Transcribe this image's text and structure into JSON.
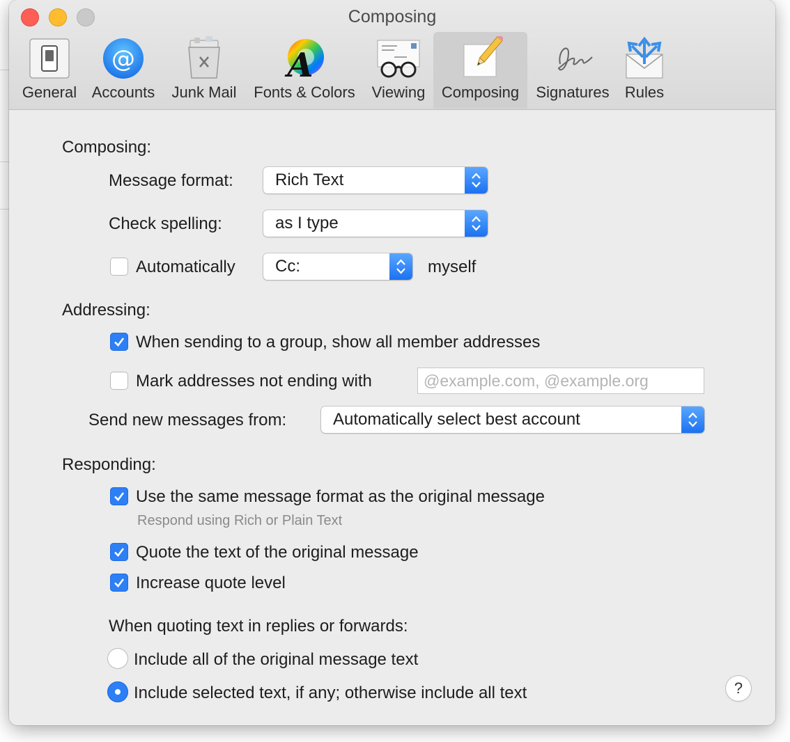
{
  "window": {
    "title": "Composing"
  },
  "toolbar": {
    "items": [
      {
        "label": "General",
        "icon": "general-switch-icon"
      },
      {
        "label": "Accounts",
        "icon": "at-sign-icon"
      },
      {
        "label": "Junk Mail",
        "icon": "trash-can-icon"
      },
      {
        "label": "Fonts & Colors",
        "icon": "font-color-wheel-icon"
      },
      {
        "label": "Viewing",
        "icon": "glasses-letter-icon"
      },
      {
        "label": "Composing",
        "icon": "pencil-paper-icon",
        "selected": true
      },
      {
        "label": "Signatures",
        "icon": "signature-icon"
      },
      {
        "label": "Rules",
        "icon": "envelope-arrows-icon"
      }
    ]
  },
  "composing": {
    "section_label": "Composing:",
    "message_format": {
      "label": "Message format:",
      "value": "Rich Text"
    },
    "check_spelling": {
      "label": "Check spelling:",
      "value": "as I type"
    },
    "auto_cc": {
      "label": "Automatically",
      "checked": false,
      "value": "Cc:",
      "suffix": "myself"
    }
  },
  "addressing": {
    "section_label": "Addressing:",
    "show_group_members": {
      "label": "When sending to a group, show all member addresses",
      "checked": true
    },
    "mark_addresses": {
      "label": "Mark addresses not ending with",
      "checked": false,
      "placeholder": "@example.com, @example.org",
      "value": ""
    },
    "send_from": {
      "label": "Send new messages from:",
      "value": "Automatically select best account"
    }
  },
  "responding": {
    "section_label": "Responding:",
    "same_format": {
      "label": "Use the same message format as the original message",
      "checked": true,
      "sublabel": "Respond using Rich or Plain Text"
    },
    "quote_text": {
      "label": "Quote the text of the original message",
      "checked": true
    },
    "increase_quote": {
      "label": "Increase quote level",
      "checked": true
    },
    "quoting_heading": "When quoting text in replies or forwards:",
    "include_all": {
      "label": "Include all of the original message text",
      "selected": false
    },
    "include_selected": {
      "label": "Include selected text, if any; otherwise include all text",
      "selected": true
    }
  },
  "help": {
    "label": "?"
  },
  "colors": {
    "accent": "#2d7ff5",
    "window_bg": "#ececec",
    "close": "#fd5f57",
    "minimize": "#febc2e"
  }
}
